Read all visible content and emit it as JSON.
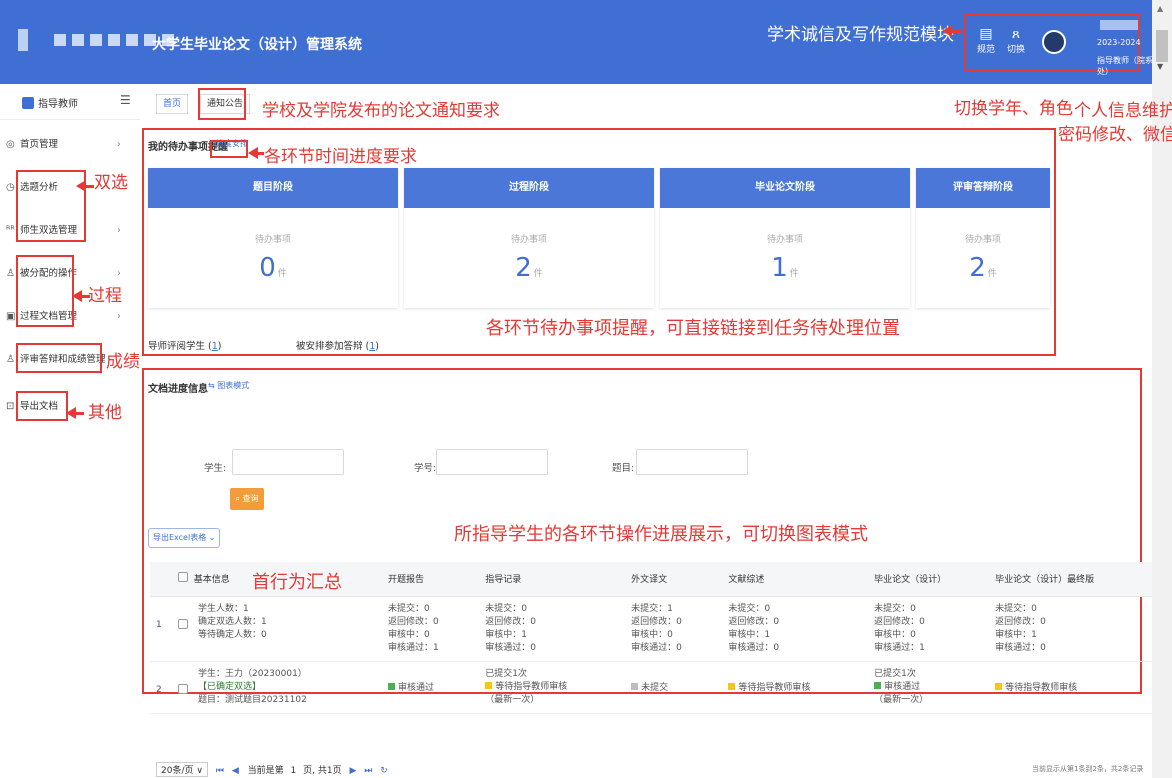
{
  "header": {
    "title": "大学生毕业论文（设计）管理系统",
    "annotation_integrity": "学术诚信及写作规范模块",
    "tools": [
      {
        "icon": "document-icon",
        "label": "规范"
      },
      {
        "icon": "switch-role-icon",
        "label": "切换"
      }
    ],
    "user": {
      "year": "2023-2024",
      "role": "指导教师（院系教务处）"
    }
  },
  "sidebar": {
    "title": "指导教师",
    "items": [
      {
        "label": "首页管理",
        "icon": "home-icon"
      },
      {
        "label": "选题分析",
        "icon": "clock-icon"
      },
      {
        "label": "师生双选管理",
        "icon": "users-icon"
      },
      {
        "label": "被分配的操作",
        "icon": "person-icon"
      },
      {
        "label": "过程文档管理",
        "icon": "file-icon"
      },
      {
        "label": "评审答辩和成绩管理",
        "icon": "person-icon"
      },
      {
        "label": "导出文档",
        "icon": "export-icon"
      }
    ]
  },
  "tabs": {
    "home": "首页",
    "notice": "通知公告"
  },
  "annotations": {
    "notice": "学校及学院发布的论文通知要求",
    "switch": "切换学年、角色",
    "profile_line1": "个人信息维护",
    "profile_line2": "密码修改、微信绑定",
    "progress_req": "各环节时间进度要求",
    "double_select": "双选",
    "process": "过程",
    "grade": "成绩",
    "other": "其他",
    "todo_hint": "各环节待办事项提醒，可直接链接到任务待处理位置",
    "doc_hint": "所指导学生的各环节操作进展展示，可切换图表模式",
    "first_row": "首行为汇总"
  },
  "todo": {
    "title": "我的待办事项提醒",
    "link": "进度安排",
    "pending_label": "待办事项",
    "unit": "件",
    "cards": [
      {
        "title": "题目阶段",
        "count": "0"
      },
      {
        "title": "过程阶段",
        "count": "2"
      },
      {
        "title": "毕业论文阶段",
        "count": "1"
      },
      {
        "title": "评审答辩阶段",
        "count": "2"
      }
    ],
    "foot1_label": "导师评阅学生",
    "foot1_value": "1",
    "foot2_label": "被安排参加答辩",
    "foot2_value": "1"
  },
  "doc": {
    "title": "文档进度信息",
    "mode_link": "图表模式",
    "filters": {
      "student": "学生:",
      "id": "学号:",
      "topic": "题目:"
    },
    "query": "查询",
    "export": "导出Excel表格",
    "columns": [
      "基本信息",
      "开题报告",
      "指导记录",
      "外文译文",
      "文献综述",
      "毕业论文（设计）",
      "毕业论文（设计）最终版"
    ],
    "summary": {
      "no": "1",
      "info": [
        "学生人数：1",
        "确定双选人数：1",
        "等待确定人数：0"
      ],
      "cells": [
        [
          "未提交：0",
          "返回修改：0",
          "审核中：0",
          "审核通过：1"
        ],
        [
          "未提交：0",
          "返回修改：0",
          "审核中：1",
          "审核通过：0"
        ],
        [
          "未提交：1",
          "返回修改：0",
          "审核中：0",
          "审核通过：0"
        ],
        [
          "未提交：0",
          "返回修改：0",
          "审核中：1",
          "审核通过：0"
        ],
        [
          "未提交：0",
          "返回修改：0",
          "审核中：0",
          "审核通过：1"
        ],
        [
          "未提交：0",
          "返回修改：0",
          "审核中：1",
          "审核通过：0"
        ]
      ]
    },
    "row2": {
      "no": "2",
      "student": "学生：王力（20230001）",
      "tag": "【已确定双选】",
      "topic": "题目：测试题目20231102",
      "c1": "审核通过",
      "c2_top": "已提交1次",
      "c2": "等待指导教师审核",
      "c2_bot": "（最新一次）",
      "c3": "未提交",
      "c4": "等待指导教师审核",
      "c5_top": "已提交1次",
      "c5": "审核通过",
      "c5_bot": "（最新一次）",
      "c6": "等待指导教师审核"
    }
  },
  "pager": {
    "size": "20条/页",
    "current_label": "当前是第",
    "page": "1",
    "total": "页, 共1页",
    "summary": "当前显示从第1条到2条，共2条记录"
  },
  "colors": {
    "primary": "#3f6fd3",
    "annotation": "#e53935",
    "ok": "#4caf50",
    "waiting": "#f5c518",
    "none": "#bdbdbd"
  }
}
